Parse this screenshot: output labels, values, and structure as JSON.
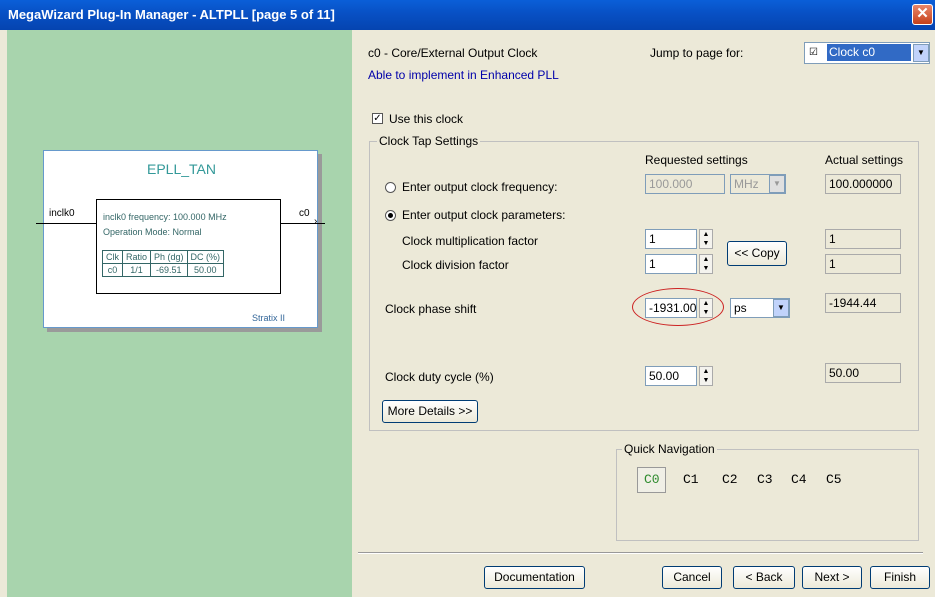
{
  "window": {
    "title": "MegaWizard Plug-In Manager - ALTPLL [page 5 of 11]",
    "close_glyph": "✕"
  },
  "diagram": {
    "block_title": "EPLL_TAN",
    "input_label": "inclk0",
    "output_label": "c0",
    "frequency_text": "inclk0 frequency: 100.000 MHz",
    "mode_text": "Operation Mode: Normal",
    "table_headers": [
      "Clk",
      "Ratio",
      "Ph (dg)",
      "DC (%)"
    ],
    "table_row": [
      "c0",
      "1/1",
      "-69.51",
      "50.00"
    ],
    "family": "Stratix II"
  },
  "header": {
    "clock_desc": "c0 - Core/External Output Clock",
    "pll_note": "Able to implement in Enhanced PLL",
    "jump_label": "Jump to page for:",
    "jump_value": "Clock c0"
  },
  "use_clock": {
    "label": "Use this clock",
    "checked": true
  },
  "clock_tap": {
    "group_title": "Clock Tap Settings",
    "requested_header": "Requested settings",
    "actual_header": "Actual settings",
    "freq_option": "Enter output clock frequency:",
    "freq_value": "100.000",
    "freq_unit": "MHz",
    "freq_actual": "100.000000",
    "params_option": "Enter output clock parameters:",
    "mult_label": "Clock multiplication factor",
    "mult_value": "1",
    "mult_actual": "1",
    "div_label": "Clock division factor",
    "div_value": "1",
    "div_actual": "1",
    "copy_label": "<< Copy",
    "phase_label": "Clock phase shift",
    "phase_value": "-1931.00",
    "phase_unit": "ps",
    "phase_actual": "-1944.44",
    "duty_label": "Clock duty cycle (%)",
    "duty_value": "50.00",
    "duty_actual": "50.00",
    "details_label": "More Details >>"
  },
  "quick_nav": {
    "title": "Quick Navigation",
    "items": [
      "C0",
      "C1",
      "C2",
      "C3",
      "C4",
      "C5"
    ],
    "active_color": "#2e8b2e"
  },
  "footer": {
    "documentation": "Documentation",
    "cancel": "Cancel",
    "back": "< Back",
    "next": "Next >",
    "finish": "Finish"
  },
  "colors": {
    "titlebar": "#0a5fd8",
    "left_panel": "#a8d4ad",
    "highlight": "#cc2222"
  }
}
